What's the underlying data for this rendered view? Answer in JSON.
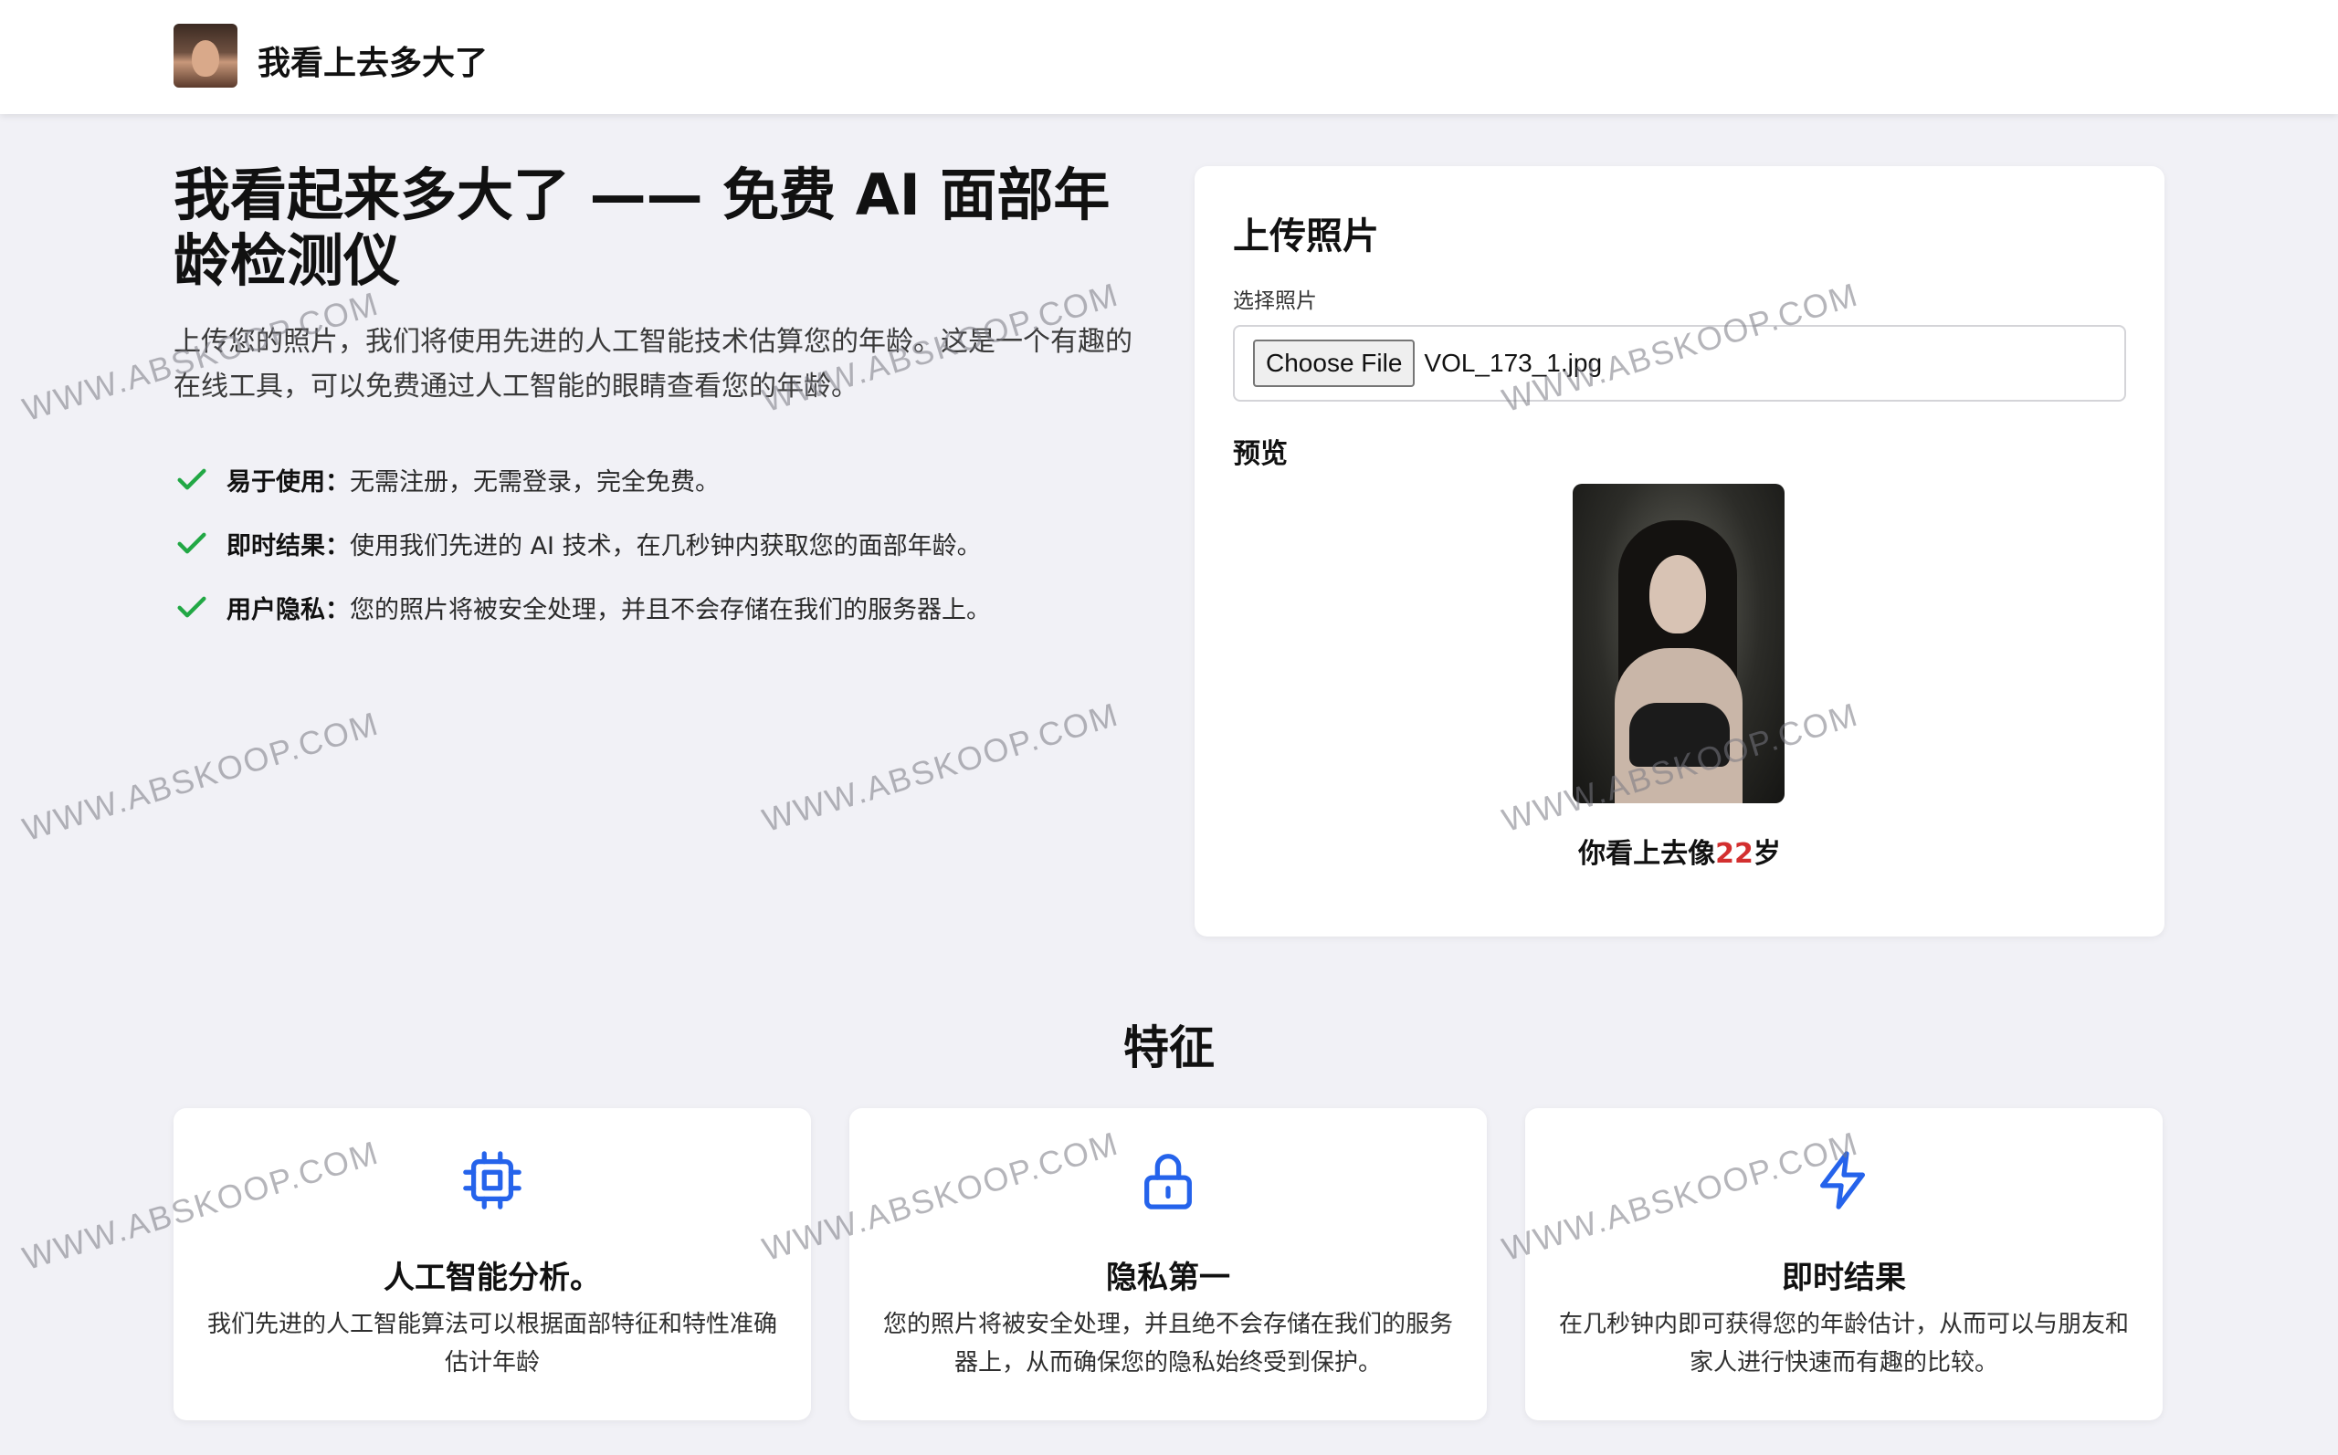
{
  "header": {
    "brand": "我看上去多大了"
  },
  "hero": {
    "title": "我看起来多大了 —— 免费 AI 面部年龄检测仪",
    "description": "上传您的照片，我们将使用先进的人工智能技术估算您的年龄。这是一个有趣的在线工具，可以免费通过人工智能的眼睛查看您的年龄。",
    "benefits": [
      {
        "label": "易于使用：",
        "text": "无需注册，无需登录，完全免费。"
      },
      {
        "label": "即时结果：",
        "text": "使用我们先进的 AI 技术，在几秒钟内获取您的面部年龄。"
      },
      {
        "label": "用户隐私：",
        "text": "您的照片将被安全处理，并且不会存储在我们的服务器上。"
      }
    ]
  },
  "upload": {
    "title": "上传照片",
    "field_label": "选择照片",
    "button_label": "Choose File",
    "file_name": "VOL_173_1.jpg",
    "preview_label": "预览",
    "result_prefix": "你看上去像",
    "result_age": "22",
    "result_suffix": "岁"
  },
  "features": {
    "title": "特征",
    "items": [
      {
        "icon": "cpu-icon",
        "title": "人工智能分析。",
        "desc": "我们先进的人工智能算法可以根据面部特征和特性准确估计年龄"
      },
      {
        "icon": "lock-icon",
        "title": "隐私第一",
        "desc": "您的照片将被安全处理，并且绝不会存储在我们的服务器上，从而确保您的隐私始终受到保护。"
      },
      {
        "icon": "lightning-icon",
        "title": "即时结果",
        "desc": "在几秒钟内即可获得您的年龄估计，从而可以与朋友和家人进行快速而有趣的比较。"
      }
    ]
  },
  "watermark": "WWW.ABSKOOP.COM",
  "colors": {
    "accent": "#2563eb",
    "check": "#22a845",
    "age": "#d32f2f",
    "background": "#f1f1f6"
  }
}
